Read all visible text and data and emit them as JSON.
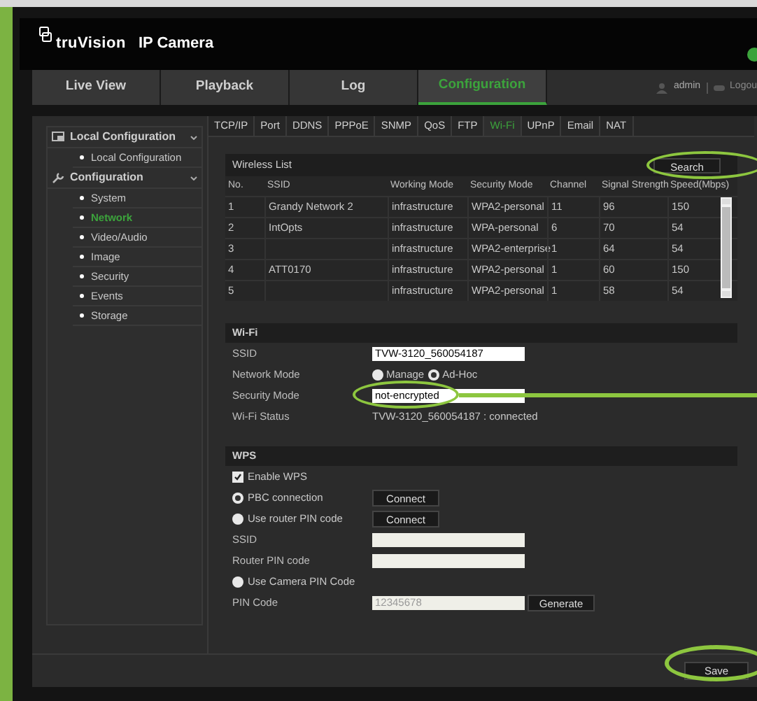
{
  "header": {
    "logo": "truVision",
    "product": "IP Camera"
  },
  "nav": [
    {
      "label": "Live View",
      "selected": false
    },
    {
      "label": "Playback",
      "selected": false
    },
    {
      "label": "Log",
      "selected": false
    },
    {
      "label": "Configuration",
      "selected": true
    }
  ],
  "user": {
    "name": "admin",
    "logout": "Logou"
  },
  "sidebar": [
    {
      "label": "Local Configuration",
      "kind": "monitor",
      "children": [
        {
          "label": "Local Configuration",
          "selected": false
        }
      ]
    },
    {
      "label": "Configuration",
      "kind": "wrench",
      "children": [
        {
          "label": "System",
          "selected": false
        },
        {
          "label": "Network",
          "selected": true
        },
        {
          "label": "Video/Audio",
          "selected": false
        },
        {
          "label": "Image",
          "selected": false
        },
        {
          "label": "Security",
          "selected": false
        },
        {
          "label": "Events",
          "selected": false
        },
        {
          "label": "Storage",
          "selected": false
        }
      ]
    }
  ],
  "tabs": [
    {
      "label": "TCP/IP",
      "selected": false
    },
    {
      "label": "Port",
      "selected": false
    },
    {
      "label": "DDNS",
      "selected": false
    },
    {
      "label": "PPPoE",
      "selected": false
    },
    {
      "label": "SNMP",
      "selected": false
    },
    {
      "label": "QoS",
      "selected": false
    },
    {
      "label": "FTP",
      "selected": false
    },
    {
      "label": "Wi-Fi",
      "selected": true
    },
    {
      "label": "UPnP",
      "selected": false
    },
    {
      "label": "Email",
      "selected": false
    },
    {
      "label": "NAT",
      "selected": false
    }
  ],
  "wireless_list": {
    "title": "Wireless List",
    "search": "Search",
    "columns": [
      "No.",
      "SSID",
      "Working Mode",
      "Security Mode",
      "Channel",
      "Signal Strength",
      "Speed(Mbps)"
    ],
    "rows": [
      [
        "1",
        "Grandy Network 2",
        "infrastructure",
        "WPA2-personal",
        "11",
        "96",
        "150"
      ],
      [
        "2",
        "IntOpts",
        "infrastructure",
        "WPA-personal",
        "6",
        "70",
        "54"
      ],
      [
        "3",
        "",
        "infrastructure",
        "WPA2-enterprise",
        "1",
        "64",
        "54"
      ],
      [
        "4",
        "ATT0170",
        "infrastructure",
        "WPA2-personal",
        "1",
        "60",
        "150"
      ],
      [
        "5",
        "",
        "infrastructure",
        "WPA2-personal",
        "1",
        "58",
        "54"
      ]
    ]
  },
  "wifi": {
    "title": "Wi-Fi",
    "ssid_label": "SSID",
    "ssid": "TVW-3120_560054187",
    "network_mode_label": "Network Mode",
    "network_modes": [
      {
        "label": "Manage",
        "selected": false
      },
      {
        "label": "Ad-Hoc",
        "selected": true
      }
    ],
    "security_mode_label": "Security Mode",
    "security_mode": "not-encrypted",
    "status_label": "Wi-Fi Status",
    "status": "TVW-3120_560054187 : connected"
  },
  "wps": {
    "title": "WPS",
    "enable_label": "Enable WPS",
    "enable_checked": true,
    "pbc_label": "PBC connection",
    "pbc_selected": true,
    "connect": "Connect",
    "router_pin_label": "Use router PIN code",
    "router_pin_selected": false,
    "connect2": "Connect",
    "ssid_label": "SSID",
    "router_pin_code_label": "Router PIN code",
    "camera_pin_label": "Use Camera PIN Code",
    "camera_pin_selected": false,
    "pin_code_label": "PIN Code",
    "pin_code": "12345678",
    "generate": "Generate"
  },
  "save": "Save"
}
